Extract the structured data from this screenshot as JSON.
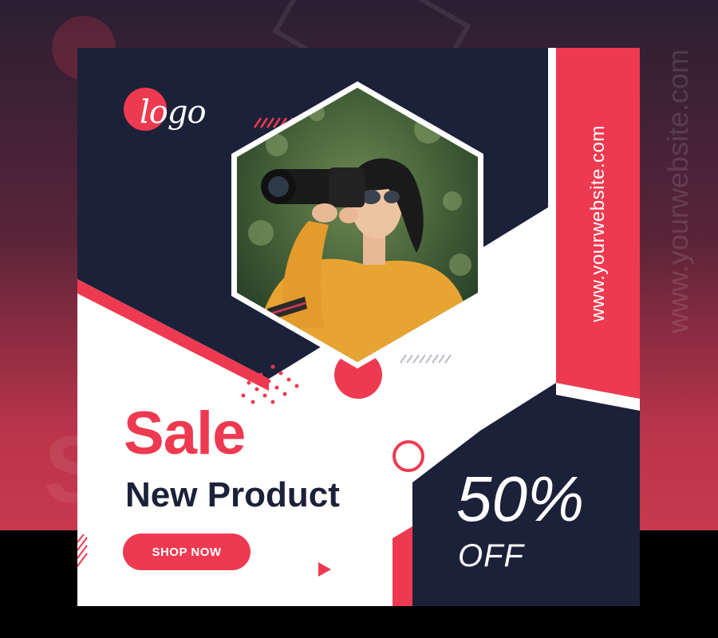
{
  "logo": {
    "text": "logo"
  },
  "website": "www.yourwebsite.com",
  "headline": {
    "sale": "Sale",
    "subtitle": "New Product"
  },
  "cta": {
    "label": "SHOP NOW"
  },
  "discount": {
    "percent": "50%",
    "suffix": "OFF"
  },
  "colors": {
    "accent": "#ee3a50",
    "navy": "#1b2139",
    "white": "#ffffff",
    "sweater": "#e8a432"
  },
  "icons": [
    "play-icon"
  ],
  "photo": {
    "subject": "woman-with-camera"
  }
}
